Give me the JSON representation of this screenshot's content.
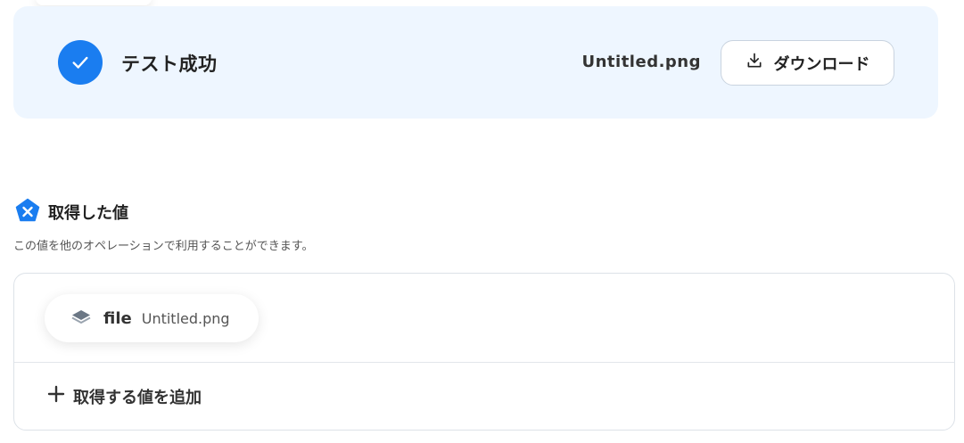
{
  "banner": {
    "status_text": "テスト成功",
    "file_name": "Untitled.png",
    "download_label": "ダウンロード",
    "accent_color": "#1a7df0"
  },
  "section": {
    "title": "取得した値",
    "description": "この値を他のオペレーションで利用することができます。"
  },
  "values": [
    {
      "key": "file",
      "value": "Untitled.png",
      "icon": "layers-icon"
    }
  ],
  "add_value_label": "取得する値を追加"
}
